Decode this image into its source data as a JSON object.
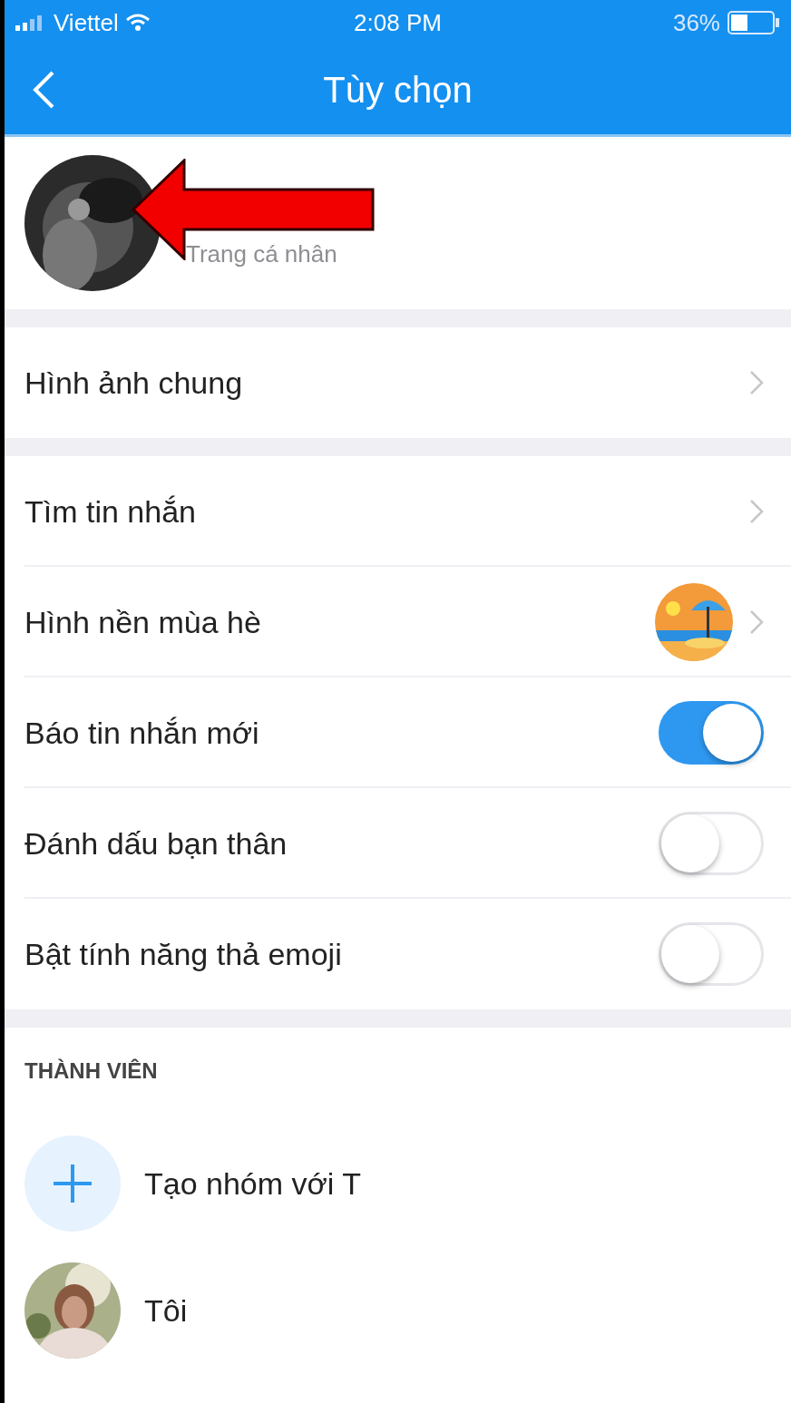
{
  "status_bar": {
    "carrier": "Viettel",
    "time": "2:08 PM",
    "battery": "36%"
  },
  "header": {
    "title": "Tùy chọn"
  },
  "profile": {
    "subtitle": "Trang cá nhân"
  },
  "groups": [
    {
      "rows": [
        {
          "kind": "link",
          "label": "Hình ảnh chung"
        }
      ]
    },
    {
      "rows": [
        {
          "kind": "link",
          "label": "Tìm tin nhắn"
        },
        {
          "kind": "wallpaper",
          "label": "Hình nền mùa hè"
        },
        {
          "kind": "toggle",
          "label": "Báo tin nhắn mới",
          "on": true
        },
        {
          "kind": "toggle",
          "label": "Đánh dấu bạn thân",
          "on": false
        },
        {
          "kind": "toggle",
          "label": "Bật tính năng thả emoji",
          "on": false
        }
      ]
    }
  ],
  "members": {
    "heading": "THÀNH VIÊN",
    "items": [
      {
        "kind": "add",
        "label": "Tạo nhóm với T"
      },
      {
        "kind": "person",
        "label": "Tôi"
      }
    ]
  }
}
